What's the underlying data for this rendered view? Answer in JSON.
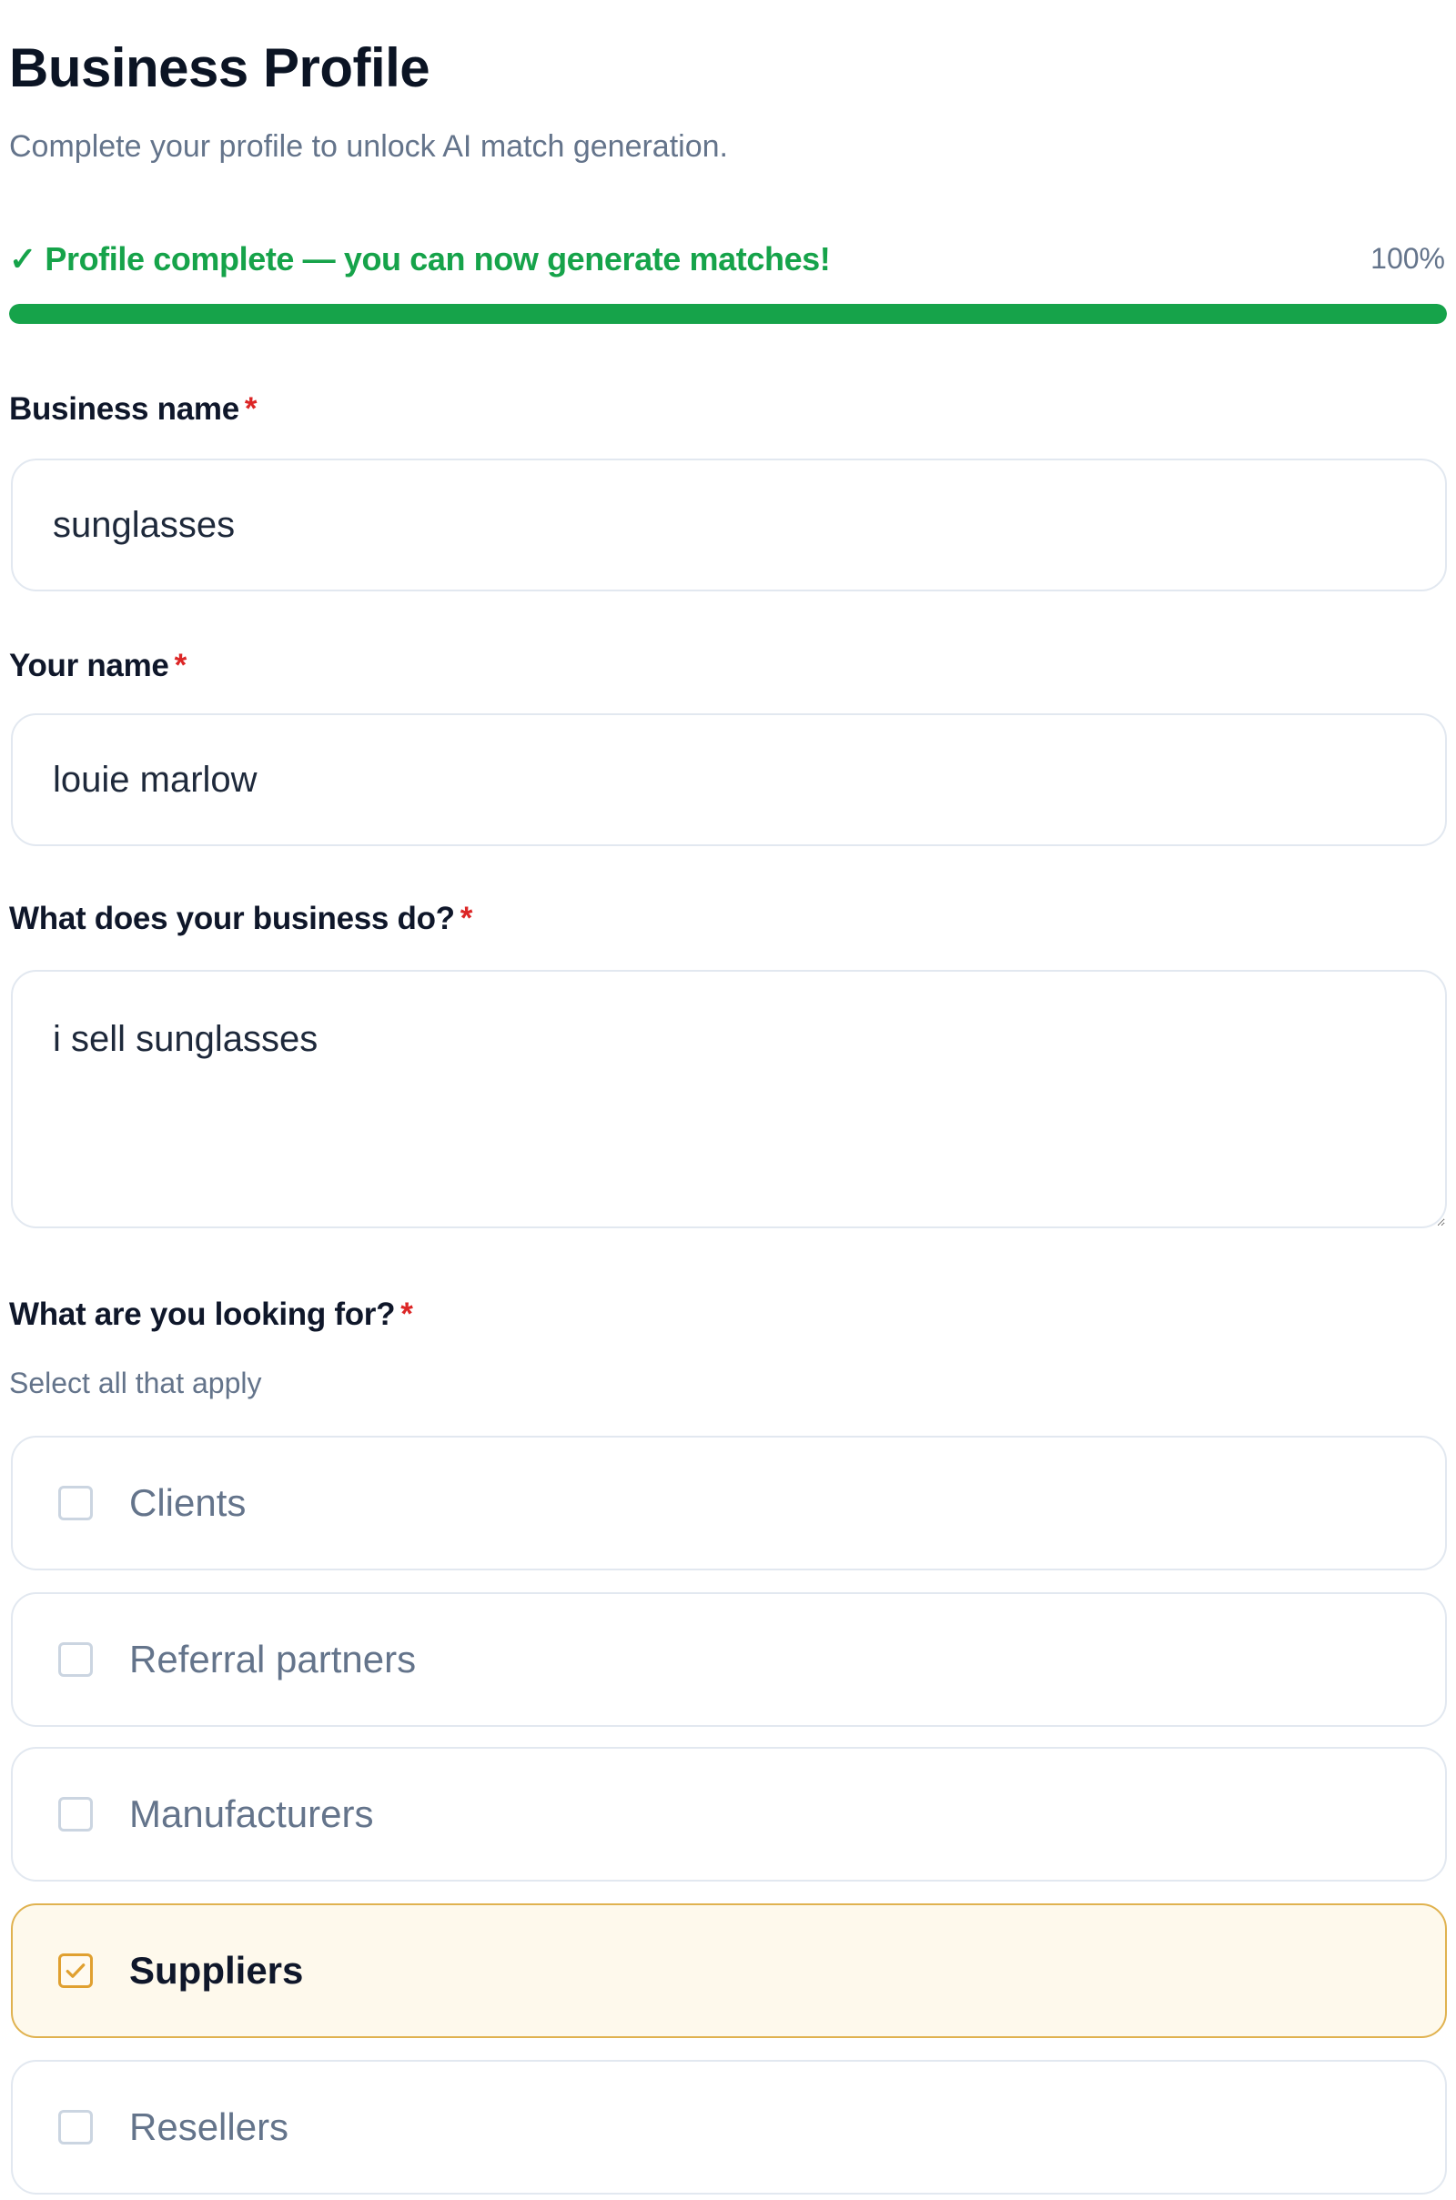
{
  "header": {
    "title": "Business Profile",
    "subtitle": "Complete your profile to unlock AI match generation."
  },
  "progress": {
    "status": "✓ Profile complete — you can now generate matches!",
    "percent_label": "100%",
    "value": 1.0,
    "color": "#16a34a"
  },
  "fields": {
    "business_name": {
      "label": "Business name",
      "required_marker": "*",
      "value": "sunglasses"
    },
    "your_name": {
      "label": "Your name",
      "required_marker": "*",
      "value": "louie marlow"
    },
    "business_description": {
      "label": "What does your business do?",
      "required_marker": "*",
      "value": "i sell sunglasses"
    }
  },
  "looking_for": {
    "label": "What are you looking for?",
    "required_marker": "*",
    "hint": "Select all that apply",
    "options": [
      {
        "label": "Clients",
        "checked": false
      },
      {
        "label": "Referral partners",
        "checked": false
      },
      {
        "label": "Manufacturers",
        "checked": false
      },
      {
        "label": "Suppliers",
        "checked": true
      },
      {
        "label": "Resellers",
        "checked": false
      }
    ]
  },
  "colors": {
    "accent_selected_border": "#e0b24f",
    "accent_selected_bg": "#fef9ec",
    "required": "#dc2626"
  }
}
